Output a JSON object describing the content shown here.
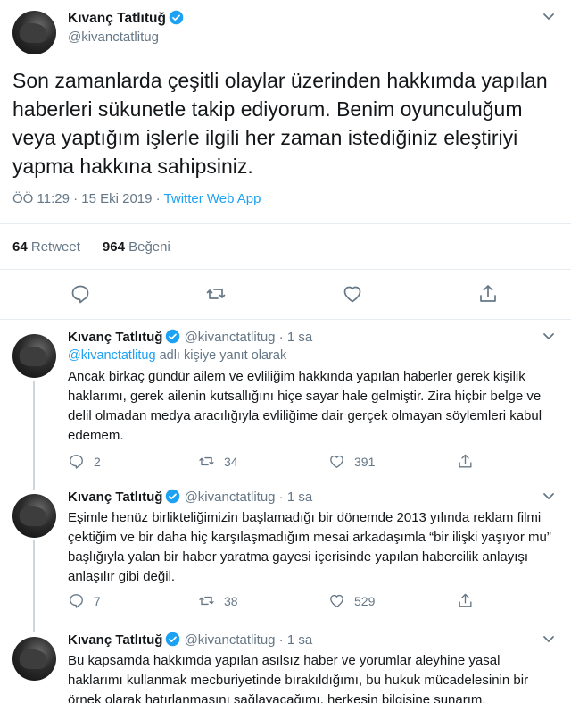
{
  "main_tweet": {
    "name": "Kıvanç Tatlıtuğ",
    "handle": "@kivanctatlitug",
    "text": "Son zamanlarda çeşitli olaylar üzerinden hakkımda yapılan haberleri sükunetle takip ediyorum. Benim oyunculuğum veya yaptığım işlerle ilgili her zaman istediğiniz eleştiriyi yapma hakkına sahipsiniz.",
    "time": "ÖÖ 11:29 · 15 Eki 2019 · ",
    "app": "Twitter Web App",
    "retweets": "64",
    "retweets_label": " Retweet",
    "likes": "964",
    "likes_label": " Beğeni"
  },
  "replies": [
    {
      "name": "Kıvanç Tatlıtuğ",
      "handle": "@kivanctatlitug · 1 sa",
      "replying_mention": "@kivanctatlitug",
      "replying_suffix": " adlı kişiye yanıt olarak",
      "text": "Ancak birkaç gündür ailem ve evliliğim hakkında yapılan haberler gerek kişilik haklarımı, gerek ailenin kutsallığını hiçe sayar hale gelmiştir. Zira hiçbir belge ve delil olmadan medya aracılığıyla evliliğime dair gerçek olmayan söylemleri kabul edemem.",
      "replies": "2",
      "retweets": "34",
      "likes": "391"
    },
    {
      "name": "Kıvanç Tatlıtuğ",
      "handle": "@kivanctatlitug · 1 sa",
      "text": "Eşimle henüz birlikteliğimizin başlamadığı bir dönemde 2013 yılında reklam filmi çektiğim ve bir daha hiç karşılaşmadığım mesai arkadaşımla “bir ilişki yaşıyor mu” başlığıyla yalan bir haber yaratma gayesi içerisinde yapılan habercilik anlayışı anlaşılır gibi değil.",
      "replies": "7",
      "retweets": "38",
      "likes": "529"
    },
    {
      "name": "Kıvanç Tatlıtuğ",
      "handle": "@kivanctatlitug · 1 sa",
      "text": "Bu kapsamda hakkımda yapılan asılsız haber ve yorumlar aleyhine yasal haklarımı kullanmak mecburiyetinde bırakıldığımı, bu hukuk mücadelesinin bir örnek olarak hatırlanmasını sağlayacağımı, herkesin bilgisine sunarım."
    }
  ],
  "colors": {
    "accent": "#1da1f2",
    "secondary_text": "#657786",
    "divider": "#e6ecf0"
  },
  "icons": [
    "verified-badge-icon",
    "chevron-down-icon",
    "reply-icon",
    "retweet-icon",
    "like-icon",
    "share-icon"
  ]
}
